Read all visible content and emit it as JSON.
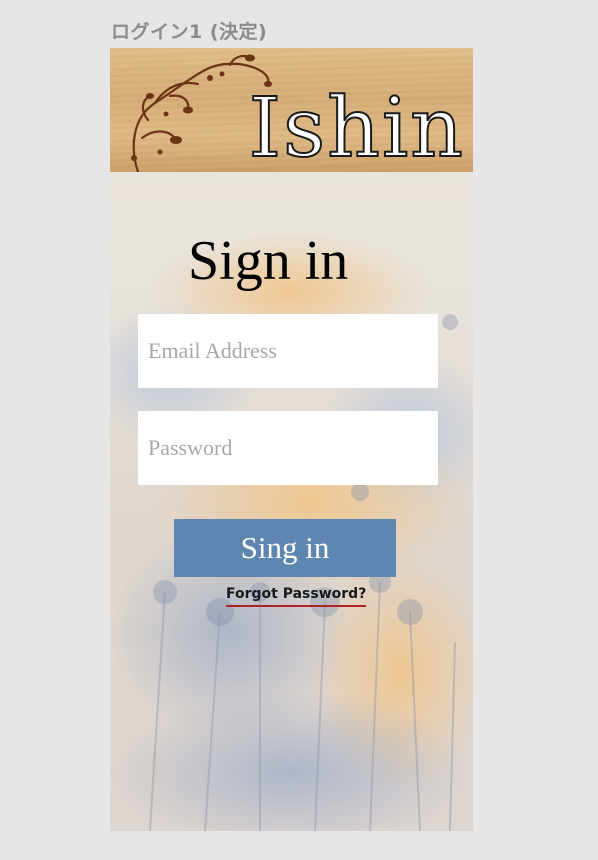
{
  "artboard": {
    "label": "ログイン1 (決定)"
  },
  "header": {
    "logo_text": "Ishin"
  },
  "signin": {
    "title": "Sign in",
    "email_placeholder": "Email Address",
    "password_placeholder": "Password",
    "button_label": "Sing in",
    "forgot_label": "Forgot Password?"
  },
  "colors": {
    "button": "#5f86b0",
    "forgot_underline": "#b32222",
    "artboard_bg": "#e6e6e6"
  }
}
